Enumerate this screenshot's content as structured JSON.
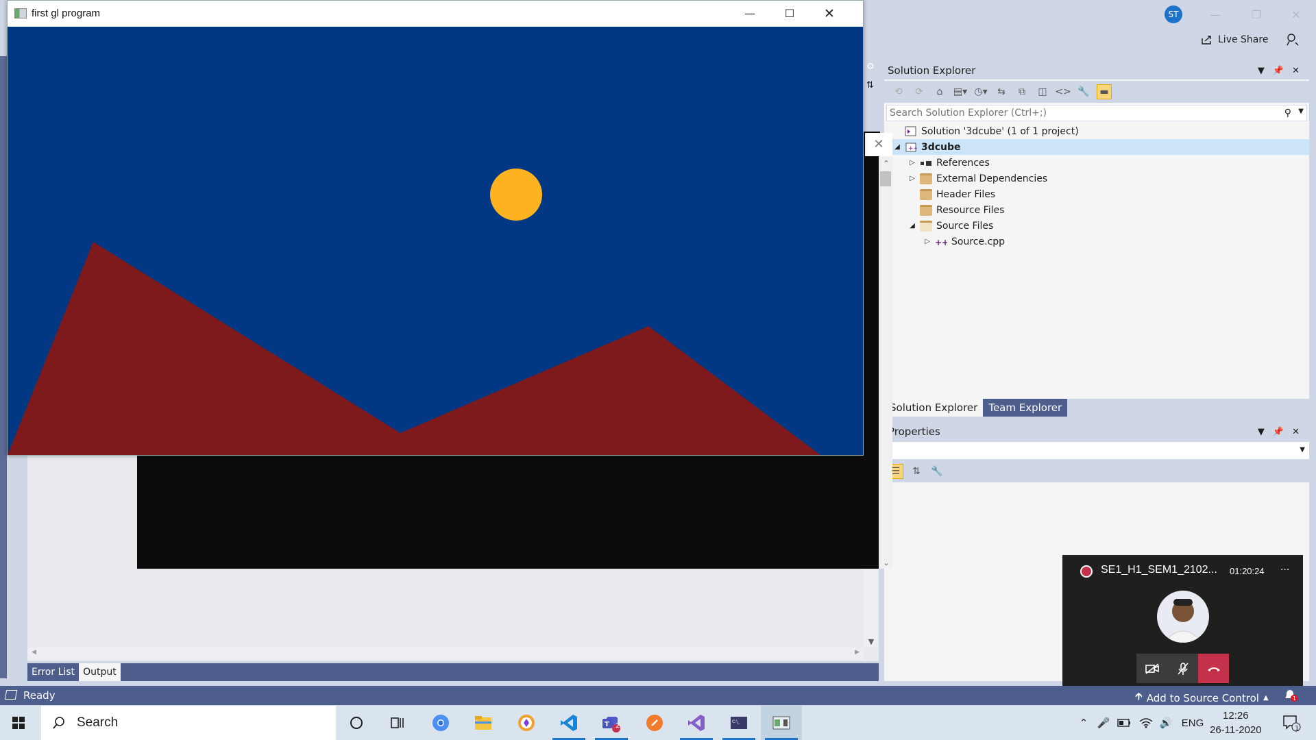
{
  "vs": {
    "avatar_initials": "ST",
    "live_share_label": "Live Share",
    "output_tabs": [
      "Error List",
      "Output"
    ],
    "active_output_tab": "Output",
    "status_text": "Ready",
    "source_control_label": "Add to Source Control",
    "notification_count": "1"
  },
  "solution_explorer": {
    "title": "Solution Explorer",
    "search_placeholder": "Search Solution Explorer (Ctrl+;)",
    "tree": [
      {
        "label": "Solution '3dcube' (1 of 1 project)",
        "level": 0,
        "arrow": "",
        "icon": "solution-icon"
      },
      {
        "label": "3dcube",
        "level": 0,
        "arrow": "expanded",
        "icon": "project-icon",
        "bold": true,
        "selected": true
      },
      {
        "label": "References",
        "level": 1,
        "arrow": "collapsed",
        "icon": "references-icon"
      },
      {
        "label": "External Dependencies",
        "level": 1,
        "arrow": "collapsed",
        "icon": "external-deps-icon"
      },
      {
        "label": "Header Files",
        "level": 1,
        "arrow": "",
        "icon": "folder-icon"
      },
      {
        "label": "Resource Files",
        "level": 1,
        "arrow": "",
        "icon": "folder-icon"
      },
      {
        "label": "Source Files",
        "level": 1,
        "arrow": "expanded",
        "icon": "folder-icon"
      },
      {
        "label": "Source.cpp",
        "level": 2,
        "arrow": "collapsed",
        "icon": "cpp-file-icon"
      }
    ],
    "tabs": [
      "Solution Explorer",
      "Team Explorer"
    ],
    "active_tab": "Solution Explorer"
  },
  "properties": {
    "title": "Properties"
  },
  "gl_window": {
    "title": "first gl program",
    "colors": {
      "sky": "#023883",
      "sun": "#FFB21F",
      "mountain": "#7F1A1C"
    }
  },
  "call": {
    "meeting_title": "SE1_H1_SEM1_2102...",
    "elapsed": "01:20:24",
    "more": "..."
  },
  "taskbar": {
    "search_label": "Search",
    "teams_badge": "2",
    "language": "ENG",
    "time": "12:26",
    "date": "26-11-2020",
    "action_center_badge": "1"
  }
}
